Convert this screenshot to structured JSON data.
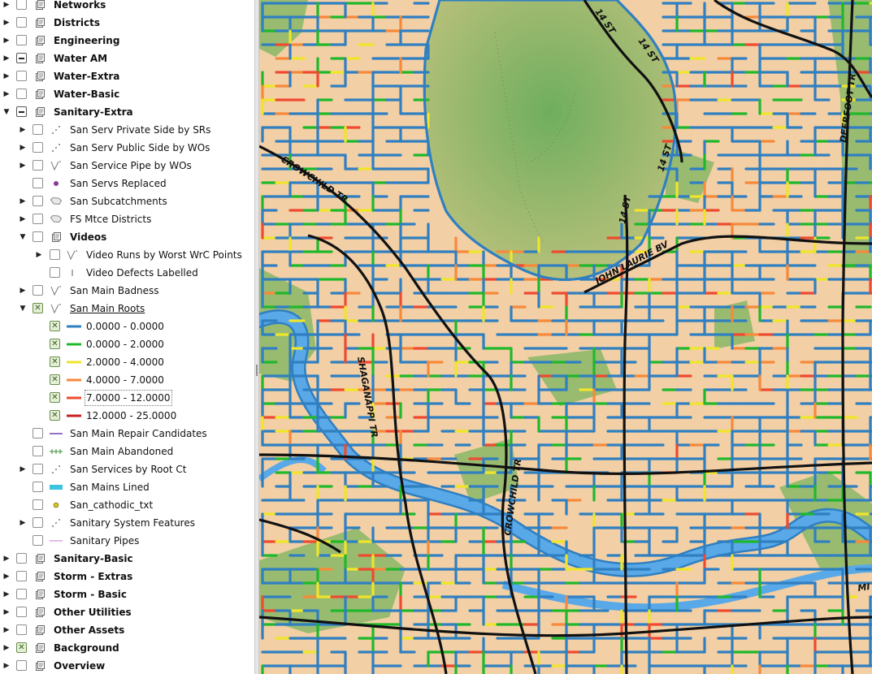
{
  "legend": {
    "rows": [
      {
        "label": "Networks",
        "indent": 0,
        "expander": "collapsed",
        "check": "unchecked",
        "symbol": "group",
        "group": true
      },
      {
        "label": "Districts",
        "indent": 0,
        "expander": "collapsed",
        "check": "unchecked",
        "symbol": "group",
        "group": true
      },
      {
        "label": "Engineering",
        "indent": 0,
        "expander": "collapsed",
        "check": "unchecked",
        "symbol": "group",
        "group": true
      },
      {
        "label": "Water AM",
        "indent": 0,
        "expander": "collapsed",
        "check": "partial",
        "symbol": "group",
        "group": true
      },
      {
        "label": "Water-Extra",
        "indent": 0,
        "expander": "collapsed",
        "check": "unchecked",
        "symbol": "group",
        "group": true
      },
      {
        "label": "Water-Basic",
        "indent": 0,
        "expander": "collapsed",
        "check": "unchecked",
        "symbol": "group",
        "group": true
      },
      {
        "label": "Sanitary-Extra",
        "indent": 0,
        "expander": "expanded",
        "check": "partial",
        "symbol": "group",
        "group": true
      },
      {
        "label": "San Serv Private Side by SRs",
        "indent": 1,
        "expander": "collapsed",
        "check": "unchecked",
        "symbol": "points-icon"
      },
      {
        "label": "San Serv Public Side by WOs",
        "indent": 1,
        "expander": "collapsed",
        "check": "unchecked",
        "symbol": "points-icon"
      },
      {
        "label": "San Service Pipe by WOs",
        "indent": 1,
        "expander": "collapsed",
        "check": "unchecked",
        "symbol": "lines-icon"
      },
      {
        "label": "San Servs Replaced",
        "indent": 1,
        "expander": "none",
        "check": "unchecked",
        "symbol": "purple-dot-icon"
      },
      {
        "label": "San Subcatchments",
        "indent": 1,
        "expander": "collapsed",
        "check": "unchecked",
        "symbol": "polygon-icon"
      },
      {
        "label": "FS Mtce Districts",
        "indent": 1,
        "expander": "collapsed",
        "check": "unchecked",
        "symbol": "polygon-icon"
      },
      {
        "label": "Videos",
        "indent": 1,
        "expander": "expanded",
        "check": "unchecked",
        "symbol": "group",
        "group": true
      },
      {
        "label": "Video Runs by Worst WrC Points",
        "indent": 2,
        "expander": "collapsed",
        "check": "unchecked",
        "symbol": "lines-icon"
      },
      {
        "label": "Video Defects Labelled",
        "indent": 2,
        "expander": "none",
        "check": "unchecked",
        "symbol": "tick-icon"
      },
      {
        "label": "San Main Badness",
        "indent": 1,
        "expander": "collapsed",
        "check": "unchecked",
        "symbol": "lines-icon"
      },
      {
        "label": "San Main Roots",
        "indent": 1,
        "expander": "expanded",
        "check": "checked",
        "symbol": "lines-icon",
        "underline": true
      },
      {
        "label": "0.0000 - 0.0000",
        "indent": 2,
        "expander": "none",
        "check": "checked",
        "symbol": "swatch",
        "color": "#2f7fc1",
        "noicon": true
      },
      {
        "label": "0.0000 - 2.0000",
        "indent": 2,
        "expander": "none",
        "check": "checked",
        "symbol": "swatch",
        "color": "#1fb82b",
        "noicon": true
      },
      {
        "label": "2.0000 - 4.0000",
        "indent": 2,
        "expander": "none",
        "check": "checked",
        "symbol": "swatch",
        "color": "#f0e52a",
        "noicon": true
      },
      {
        "label": "4.0000 - 7.0000",
        "indent": 2,
        "expander": "none",
        "check": "checked",
        "symbol": "swatch",
        "color": "#f7893a",
        "noicon": true
      },
      {
        "label": "7.0000 - 12.0000",
        "indent": 2,
        "expander": "none",
        "check": "checked",
        "symbol": "swatch",
        "color": "#ee4a30",
        "noicon": true,
        "selected": true
      },
      {
        "label": "12.0000 - 25.0000",
        "indent": 2,
        "expander": "none",
        "check": "checked",
        "symbol": "swatch",
        "color": "#c81e1e",
        "noicon": true
      },
      {
        "label": "San Main Repair Candidates",
        "indent": 1,
        "expander": "none",
        "check": "unchecked",
        "symbol": "swatch",
        "color": "#9a6fc8"
      },
      {
        "label": "San Main Abandoned",
        "indent": 1,
        "expander": "none",
        "check": "unchecked",
        "symbol": "hatched-line-icon",
        "color": "#5aa05a"
      },
      {
        "label": "San Services by Root Ct",
        "indent": 1,
        "expander": "collapsed",
        "check": "unchecked",
        "symbol": "points-icon"
      },
      {
        "label": "San Mains Lined",
        "indent": 1,
        "expander": "none",
        "check": "unchecked",
        "symbol": "thick-swatch",
        "color": "#3cc3e0"
      },
      {
        "label": "San_cathodic_txt",
        "indent": 1,
        "expander": "none",
        "check": "unchecked",
        "symbol": "yellow-dot-icon"
      },
      {
        "label": "Sanitary System Features",
        "indent": 1,
        "expander": "collapsed",
        "check": "unchecked",
        "symbol": "points-icon"
      },
      {
        "label": "Sanitary Pipes",
        "indent": 1,
        "expander": "none",
        "check": "unchecked",
        "symbol": "thin-swatch",
        "color": "#c77fd0"
      },
      {
        "label": "Sanitary-Basic",
        "indent": 0,
        "expander": "collapsed",
        "check": "unchecked",
        "symbol": "group",
        "group": true
      },
      {
        "label": "Storm - Extras",
        "indent": 0,
        "expander": "collapsed",
        "check": "unchecked",
        "symbol": "group",
        "group": true
      },
      {
        "label": "Storm - Basic",
        "indent": 0,
        "expander": "collapsed",
        "check": "unchecked",
        "symbol": "group",
        "group": true
      },
      {
        "label": "Other Utilities",
        "indent": 0,
        "expander": "collapsed",
        "check": "unchecked",
        "symbol": "group",
        "group": true
      },
      {
        "label": "Other Assets",
        "indent": 0,
        "expander": "collapsed",
        "check": "unchecked",
        "symbol": "group",
        "group": true
      },
      {
        "label": "Background",
        "indent": 0,
        "expander": "collapsed",
        "check": "checked",
        "symbol": "group",
        "group": true
      },
      {
        "label": "Overview",
        "indent": 0,
        "expander": "collapsed",
        "check": "unchecked",
        "symbol": "group",
        "group": true
      }
    ]
  },
  "map": {
    "street_labels": [
      "14 ST",
      "14 ST",
      "14 ST",
      "14 ST",
      "DEERFOOT TR",
      "CROWCHILD TR",
      "JOHN LAURIE BV",
      "SHAGANAPPI TR",
      "CROWCHILD TR",
      "MI"
    ],
    "colors": {
      "land": "#f2cfa5",
      "park": "#8fb86a",
      "lake": "#9cc07a",
      "river": "#59a8e8",
      "main": "#2f7fc1",
      "road": "#111111",
      "class_green": "#1fb82b",
      "class_yellow": "#f0e52a",
      "class_orange": "#f7893a",
      "class_red": "#ee4a30",
      "class_darkred": "#c81e1e"
    }
  }
}
